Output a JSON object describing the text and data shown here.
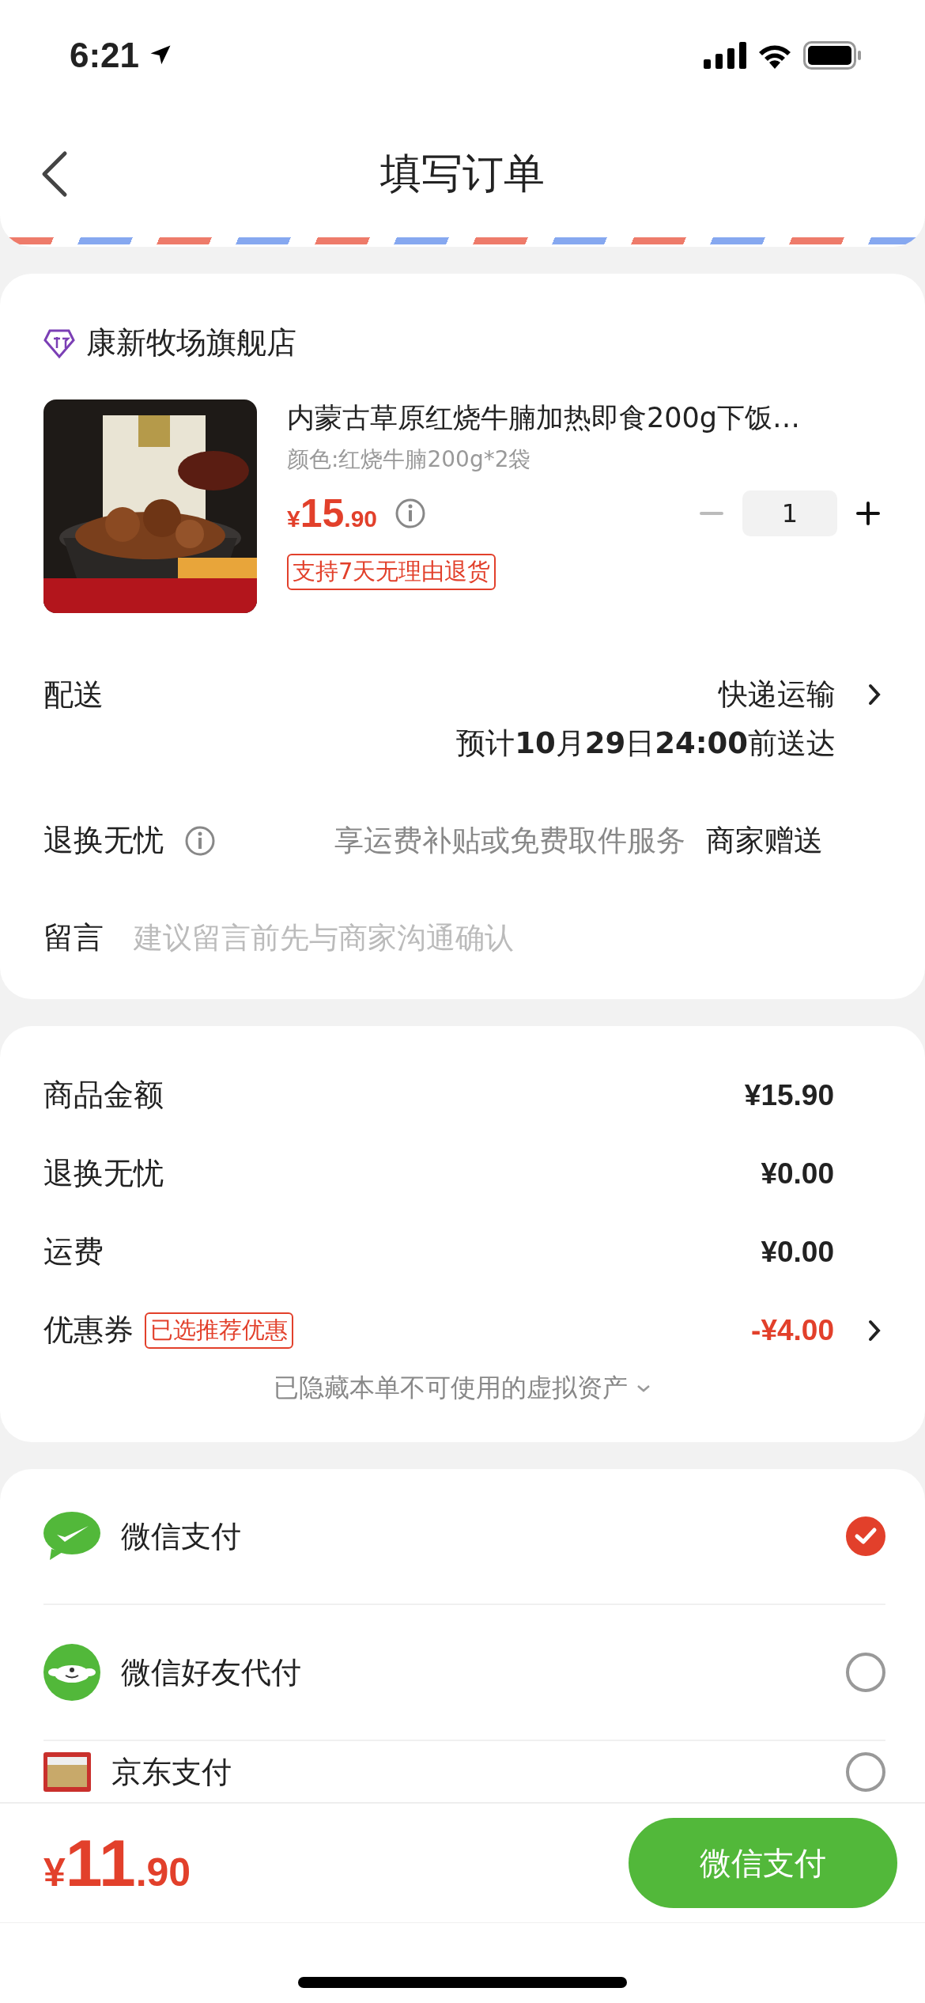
{
  "status_bar": {
    "time": "6:21"
  },
  "nav": {
    "title": "填写订单"
  },
  "store": {
    "name": "康新牧场旗舰店"
  },
  "product": {
    "title": "内蒙古草原红烧牛腩加热即食200g下饭…",
    "spec": "颜色:红烧牛腩200g*2袋",
    "price_symbol": "¥",
    "price_int": "15",
    "price_dec": ".90",
    "quantity": "1",
    "minus_disabled": true,
    "tag": "支持7天无理由退货"
  },
  "delivery": {
    "label": "配送",
    "method": "快递运输",
    "eta": "预计**10**月**29**日**24:00**前送达"
  },
  "return_service": {
    "label": "退换无忧",
    "desc": "享运费补贴或免费取件服务",
    "value": "商家赠送"
  },
  "message": {
    "label": "留言",
    "placeholder": "建议留言前先与商家沟通确认"
  },
  "fees": [
    {
      "kind": "plain",
      "label": "商品金额",
      "amount": "¥15.90"
    },
    {
      "kind": "plain",
      "label": "退换无忧",
      "amount": "¥0.00"
    },
    {
      "kind": "plain",
      "label": "运费",
      "amount": "¥0.00"
    },
    {
      "kind": "discount",
      "label": "优惠券",
      "tag": "已选推荐优惠",
      "amount": "-¥4.00"
    }
  ],
  "hidden_assets": "已隐藏本单不可使用的虚拟资产",
  "payments": [
    {
      "kind": "wechat",
      "name": "微信支付",
      "selected": true
    },
    {
      "kind": "friend",
      "name": "微信好友代付",
      "selected": false
    },
    {
      "kind": "card",
      "name": "京东支付",
      "selected": false
    }
  ],
  "footer": {
    "price_symbol": "¥",
    "price_int": "11",
    "price_dec": ".90",
    "pay_button": "微信支付"
  }
}
